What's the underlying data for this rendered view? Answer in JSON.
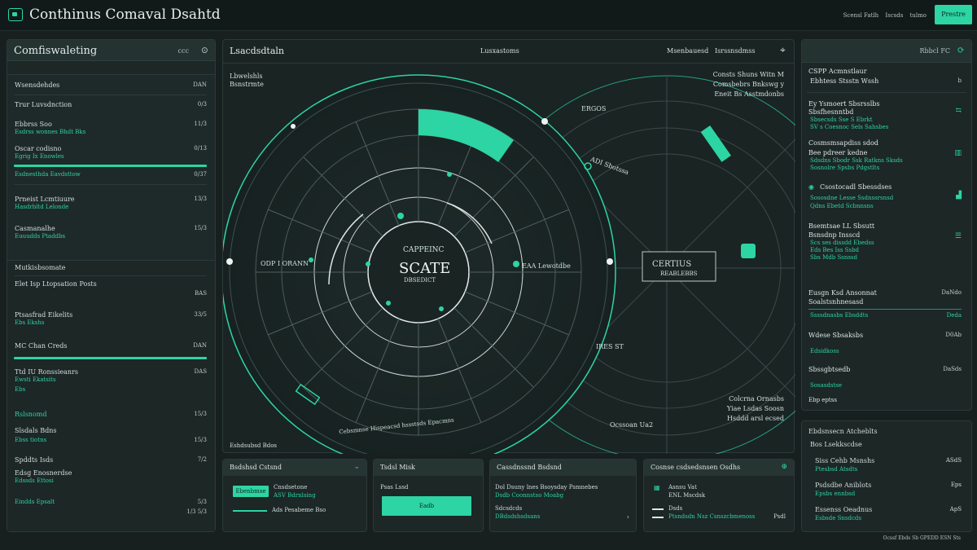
{
  "app": {
    "title": "Conthinus Comaval Dsahtd",
    "top_links": [
      "Scensl Fatlh",
      "Iscsds",
      "tulmo"
    ],
    "top_button": "Prestre"
  },
  "left_panel": {
    "title": "Comfiswaleting",
    "header_right": "ccc",
    "section1": {
      "title": "Wsensdehdes",
      "value": "DAN",
      "rows": [
        {
          "label": "Trur Luvsdnction",
          "value": "0/3"
        },
        {
          "label": "Ebbrss Soo",
          "sub": "Esdrss wonnes Bhdt Bks",
          "value": "11/3"
        },
        {
          "label": "Oscar codisno",
          "sub": "Egrig Ix Enowles",
          "value": "0/13"
        },
        {
          "label": "Esdnesthda Eavdsttow",
          "value": "0/37"
        },
        {
          "label": "Prneist Lcmtiuure",
          "sub": "Hasdrbltd Lelonde",
          "value": "13/3"
        },
        {
          "label": "Casmanalhe",
          "sub": "Euuudds Ptaddbs",
          "value": "15/3"
        }
      ]
    },
    "section2": {
      "title": "Mutkisbsomate",
      "rows": [
        {
          "label": "Elet Isp Ltopsation Posts",
          "value": "BAS"
        },
        {
          "label": "Ptsasfrad Eikelits",
          "sub": "Ebs Ekshs",
          "value": "33/5"
        },
        {
          "label": "MC Chan Creds",
          "value": "DAN"
        },
        {
          "label": "Ttd IU Ronssieanrs",
          "sub": "Ewsti Ekatsits",
          "sub2": "Ebs",
          "value": "DAS"
        },
        {
          "label": "Rslsnomd",
          "value": "15/3"
        },
        {
          "label": "Slsdals Bdns",
          "sub": "Ebss tiotns",
          "value": "15/3"
        },
        {
          "label": "Spddts Isds",
          "value": "7/2"
        },
        {
          "label": "Edsg Enosnerdse",
          "sub": "Edssds Ettosi",
          "sub2": "Eindds Epsalt",
          "value": "5/3",
          "value2": "1/3 5/3"
        }
      ]
    }
  },
  "center_panel": {
    "title": "Lsacdsdtaln",
    "tab_mid": "Lusxastoms",
    "tab_right1": "Msenbauesd",
    "tab_right2": "Isrssnsdmss",
    "top_left": [
      "Lbwelshls",
      "Bsnstrmte"
    ],
    "top_right": [
      "Consts Shuns Witn M",
      "Comsbebrs Bnkswg y",
      "Eneit Bs Asstmdonbs"
    ],
    "core_top": "CAPPEINC",
    "core_main": "SCATE",
    "core_sub": "DBSEDICT",
    "left_label": "ODP I ORANN",
    "mid_label": "EAA Lewotdbe",
    "right_core_title": "CERTIUS",
    "right_core_sub": "REABLEBBS",
    "top_bar_label": "ERGOS",
    "diag_label": "ADI Sbotssa",
    "mid_right_label": "IRES ST",
    "bottom_right": [
      "Colcrna Ornasbs",
      "Yiae Lsdas Soosn",
      "Hsddd arsl ecsed"
    ],
    "bottom_mid": "Ocssoan Ua2",
    "bottom_left": "Eshdsubsd Bdos",
    "ring_text": "Cebsmnse Hispeacsd hssstsds Epacmns"
  },
  "right_panel": {
    "title": "Rbbcl FC",
    "sections": [
      {
        "title": "CSPP Acmnstlaur",
        "sub": "Ebhtess Stsstn Wssh",
        "value": "b"
      },
      {
        "title": "Ey Ysmoert Sbsrsslbs",
        "lines": [
          "Sbsfhesnntbd",
          "Sbsecsds Sse S Ebrkt",
          "SV s Coesnoc Sels Sahsbes"
        ]
      },
      {
        "title": "Cosmsmsapdiss sdod",
        "sub": "Bee pdreer kedne",
        "lines": [
          "Sdsdns Sbodr Ssk Ratkns Sksds",
          "Sosnolre Spsbs Pdgstlts"
        ]
      },
      {
        "title": "Csostocadl Sbessdses",
        "lines": [
          "Sososdne Lesse Ssdnssrsnsd",
          "Qdns Ebetd Scbnnsns"
        ]
      },
      {
        "title": "Bsemtsae LL Sbsutt",
        "sub": "Bsnsdnp Insscd",
        "lines": [
          "Scs ses dissdd Ebedss",
          "Eds Bes Iss Ssbd",
          "Sbs Mdb Ssnssd"
        ]
      },
      {
        "title": "Eusgn Ksd Ansonnat",
        "sub": "Soalstsnhnesasd",
        "value": "DaNdo"
      },
      {
        "title": "Ssssdnasbs Ebsddts",
        "value": "Deda"
      },
      {
        "title": "Wdese Sbsaksbs",
        "sub": "Edsidkoss",
        "value": "D0Ab"
      },
      {
        "title": "Sbssgbtsedb",
        "sub": "Sosasdstse",
        "value": "DaSds",
        "extra": "Ebp eptss"
      }
    ]
  },
  "right_bottom": {
    "title": "Ebdsnsecn Atcheblts",
    "sub": "Bos Lsekkscdse",
    "rows": [
      {
        "label": "Siss Cehb Msnshs",
        "sub": "Ptesbsd Atsdts",
        "value": "ASdS"
      },
      {
        "label": "Psdsdbe Aniblots",
        "sub": "Epsbs ennbsd",
        "value": "Eps"
      },
      {
        "label": "Essenss Oeadnus",
        "sub": "Esbsde Snsdcds",
        "value": "ApS"
      }
    ]
  },
  "bottom_cards": [
    {
      "title": "Bsdshsd Cstsnd",
      "button": "Ebenbmse",
      "lines": [
        "Cnsdsetone",
        "ASV Bdrnlsing",
        "Ads Pesabeme Bso"
      ]
    },
    {
      "title": "Tsdsl Misk",
      "sub": "Psas Lssd",
      "button": "Eadb"
    },
    {
      "title": "Cassdnssnd Bsdsnd",
      "lines": [
        "Dol Dsuny lnes Bsoysday Psmnebes",
        "Dsdb Coonnstso Moabg",
        "Sdcsdcds",
        "DBdsdshsdsans"
      ]
    },
    {
      "title": "Cosnse csdsedsnsen Osdhs",
      "lines": [
        "Asnsu Vat",
        "ENL Mscdsk",
        "Dsds",
        "Ptsndsdn Nsz Csnszcbmenoss"
      ],
      "value": "Psdl"
    }
  ],
  "footer": "Ocssf Ebds Sb GPEDD ESN Sts",
  "colors": {
    "accent": "#2dd4a4",
    "background": "#17201f",
    "panel": "#1c2726"
  }
}
